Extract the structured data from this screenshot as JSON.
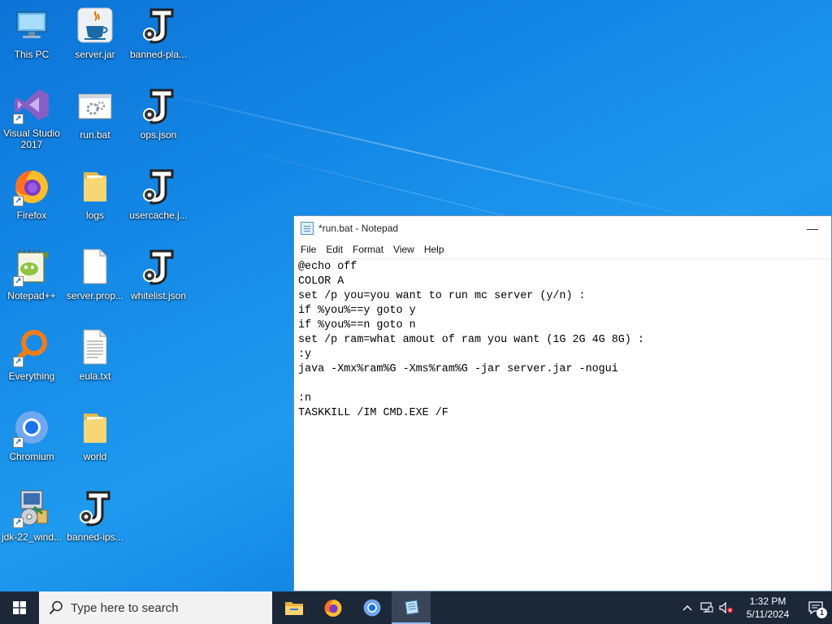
{
  "desktop": {
    "icons": [
      {
        "label": "This PC"
      },
      {
        "label": "server.jar"
      },
      {
        "label": "banned-pla..."
      },
      {
        "label": "Visual Studio 2017"
      },
      {
        "label": "run.bat"
      },
      {
        "label": "ops.json"
      },
      {
        "label": "Firefox"
      },
      {
        "label": "logs"
      },
      {
        "label": "usercache.j..."
      },
      {
        "label": "Notepad++"
      },
      {
        "label": "server.prop..."
      },
      {
        "label": "whitelist.json"
      },
      {
        "label": "Everything"
      },
      {
        "label": "eula.txt"
      },
      {
        "label": "Chromium"
      },
      {
        "label": "world"
      },
      {
        "label": "jdk-22_wind..."
      },
      {
        "label": "banned-ips..."
      }
    ]
  },
  "notepad": {
    "title": "*run.bat - Notepad",
    "minimize": "—",
    "menu": [
      "File",
      "Edit",
      "Format",
      "View",
      "Help"
    ],
    "lines": [
      "@echo off",
      "COLOR A",
      "set /p you=you want to run mc server (y/n) :",
      "if %you%==y goto y",
      "if %you%==n goto n",
      "set /p ram=what amout of ram you want (1G 2G 4G 8G) :",
      ":y",
      "java -Xmx%ram%G -Xms%ram%G -jar server.jar -nogui",
      "",
      ":n",
      "TASKKILL /IM CMD.EXE /F"
    ]
  },
  "taskbar": {
    "search_placeholder": "Type here to search",
    "apps": [
      "file-explorer-icon",
      "firefox-icon",
      "chromium-icon",
      "notepad-icon"
    ],
    "clock_time": "1:32 PM",
    "clock_date": "5/11/2024",
    "notification_count": "1"
  },
  "colors": {
    "taskbar_bg": "#1c2738",
    "desktop_blue": "#1488e6",
    "accent": "#0078d7"
  }
}
